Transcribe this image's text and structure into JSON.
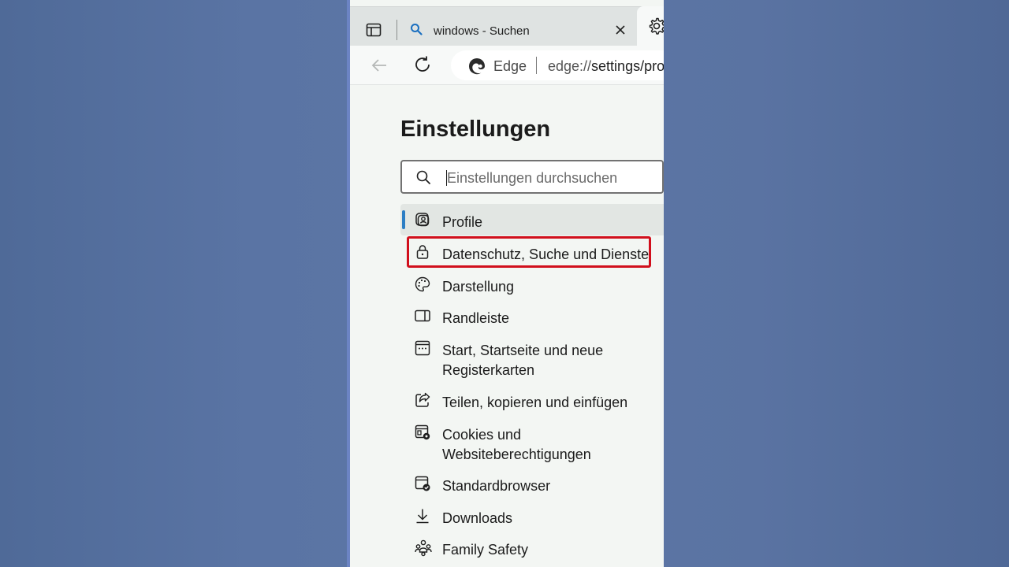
{
  "tab": {
    "title": "windows - Suchen"
  },
  "addressbar": {
    "site_label": "Edge",
    "url_prefix": "edge://",
    "url_main": "settings/pro"
  },
  "settings": {
    "title": "Einstellungen",
    "search_placeholder": "Einstellungen durchsuchen",
    "items": [
      {
        "label": "Profile",
        "icon": "profile-icon",
        "selected": true
      },
      {
        "label": "Datenschutz, Suche und Dienste",
        "icon": "lock-icon",
        "highlighted": true
      },
      {
        "label": "Darstellung",
        "icon": "palette-icon"
      },
      {
        "label": "Randleiste",
        "icon": "sidebar-icon"
      },
      {
        "label": "Start, Startseite und neue Registerkarten",
        "icon": "home-tabs-icon"
      },
      {
        "label": "Teilen, kopieren und einfügen",
        "icon": "share-icon"
      },
      {
        "label": "Cookies und Websiteberechtigungen",
        "icon": "cookies-icon"
      },
      {
        "label": "Standardbrowser",
        "icon": "default-browser-icon"
      },
      {
        "label": "Downloads",
        "icon": "download-icon"
      },
      {
        "label": "Family Safety",
        "icon": "family-icon"
      }
    ]
  },
  "colors": {
    "accent": "#2b7dc4",
    "highlight": "#d10f1c",
    "background": "#5a74a4"
  }
}
